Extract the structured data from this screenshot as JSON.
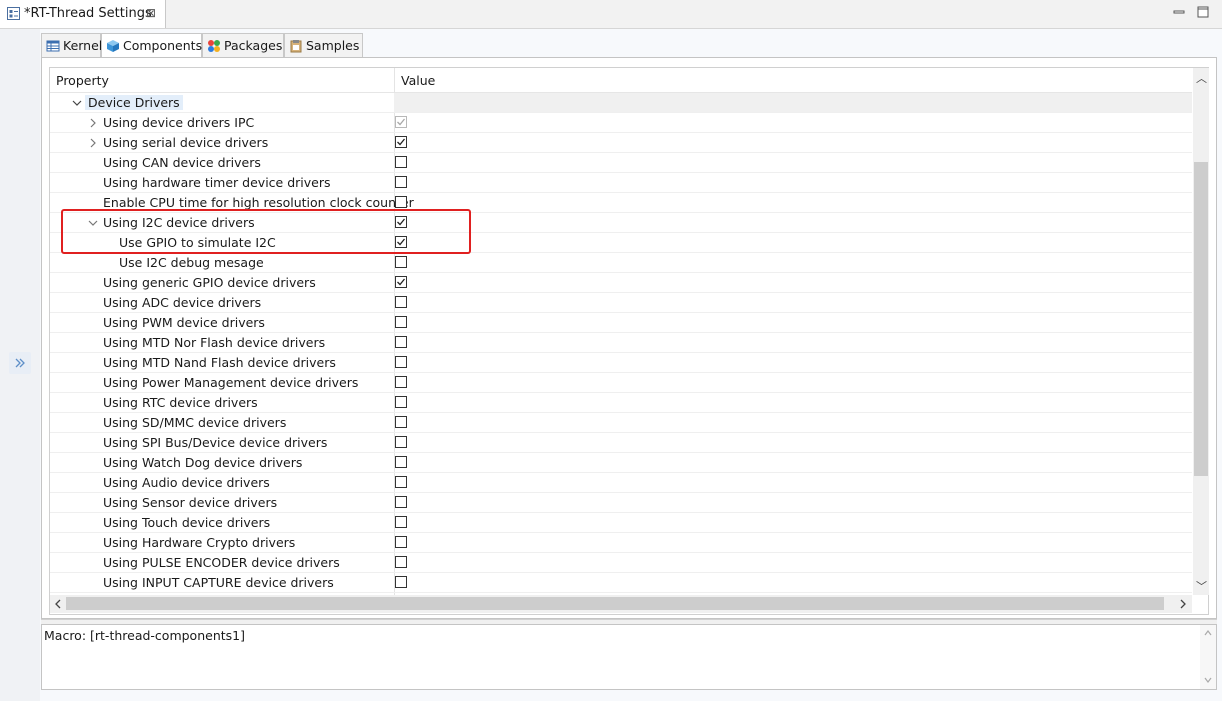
{
  "editor_tab": {
    "title": "*RT-Thread Settings",
    "close_glyph": "⊠"
  },
  "config_tabs": [
    {
      "label": "Kernel",
      "icon": "table-icon"
    },
    {
      "label": "Components",
      "icon": "cube-icon"
    },
    {
      "label": "Packages",
      "icon": "puzzle-icon"
    },
    {
      "label": "Samples",
      "icon": "clipboard-icon"
    }
  ],
  "tree": {
    "header_property": "Property",
    "header_value": "Value",
    "group": "Device Drivers",
    "rows": [
      {
        "label": "Using device drivers IPC",
        "checked": true,
        "disabled": true,
        "expander": "collapsed"
      },
      {
        "label": "Using serial device drivers",
        "checked": true,
        "expander": "collapsed"
      },
      {
        "label": "Using CAN device drivers",
        "checked": false
      },
      {
        "label": "Using hardware timer device drivers",
        "checked": false
      },
      {
        "label": "Enable CPU time for high resolution clock counter",
        "checked": false
      },
      {
        "label": "Using I2C device drivers",
        "checked": true,
        "expander": "expanded"
      },
      {
        "label": "Use GPIO to simulate I2C",
        "checked": true,
        "child": true
      },
      {
        "label": "Use I2C debug mesage",
        "checked": false,
        "child": true
      },
      {
        "label": "Using generic GPIO device drivers",
        "checked": true
      },
      {
        "label": "Using ADC device drivers",
        "checked": false
      },
      {
        "label": "Using PWM device drivers",
        "checked": false
      },
      {
        "label": "Using MTD Nor Flash device drivers",
        "checked": false
      },
      {
        "label": "Using MTD Nand Flash device drivers",
        "checked": false
      },
      {
        "label": "Using Power Management device drivers",
        "checked": false
      },
      {
        "label": "Using RTC device drivers",
        "checked": false
      },
      {
        "label": "Using SD/MMC device drivers",
        "checked": false
      },
      {
        "label": "Using SPI Bus/Device device drivers",
        "checked": false
      },
      {
        "label": "Using Watch Dog device drivers",
        "checked": false
      },
      {
        "label": "Using Audio device drivers",
        "checked": false
      },
      {
        "label": "Using Sensor device drivers",
        "checked": false
      },
      {
        "label": "Using Touch device drivers",
        "checked": false
      },
      {
        "label": "Using Hardware Crypto drivers",
        "checked": false
      },
      {
        "label": "Using PULSE ENCODER device drivers",
        "checked": false
      },
      {
        "label": "Using INPUT CAPTURE device drivers",
        "checked": false
      }
    ]
  },
  "macro": {
    "text": "Macro: [rt-thread-components1]"
  },
  "colors": {
    "highlight": "#e02020",
    "accent": "#2f6fb5"
  }
}
